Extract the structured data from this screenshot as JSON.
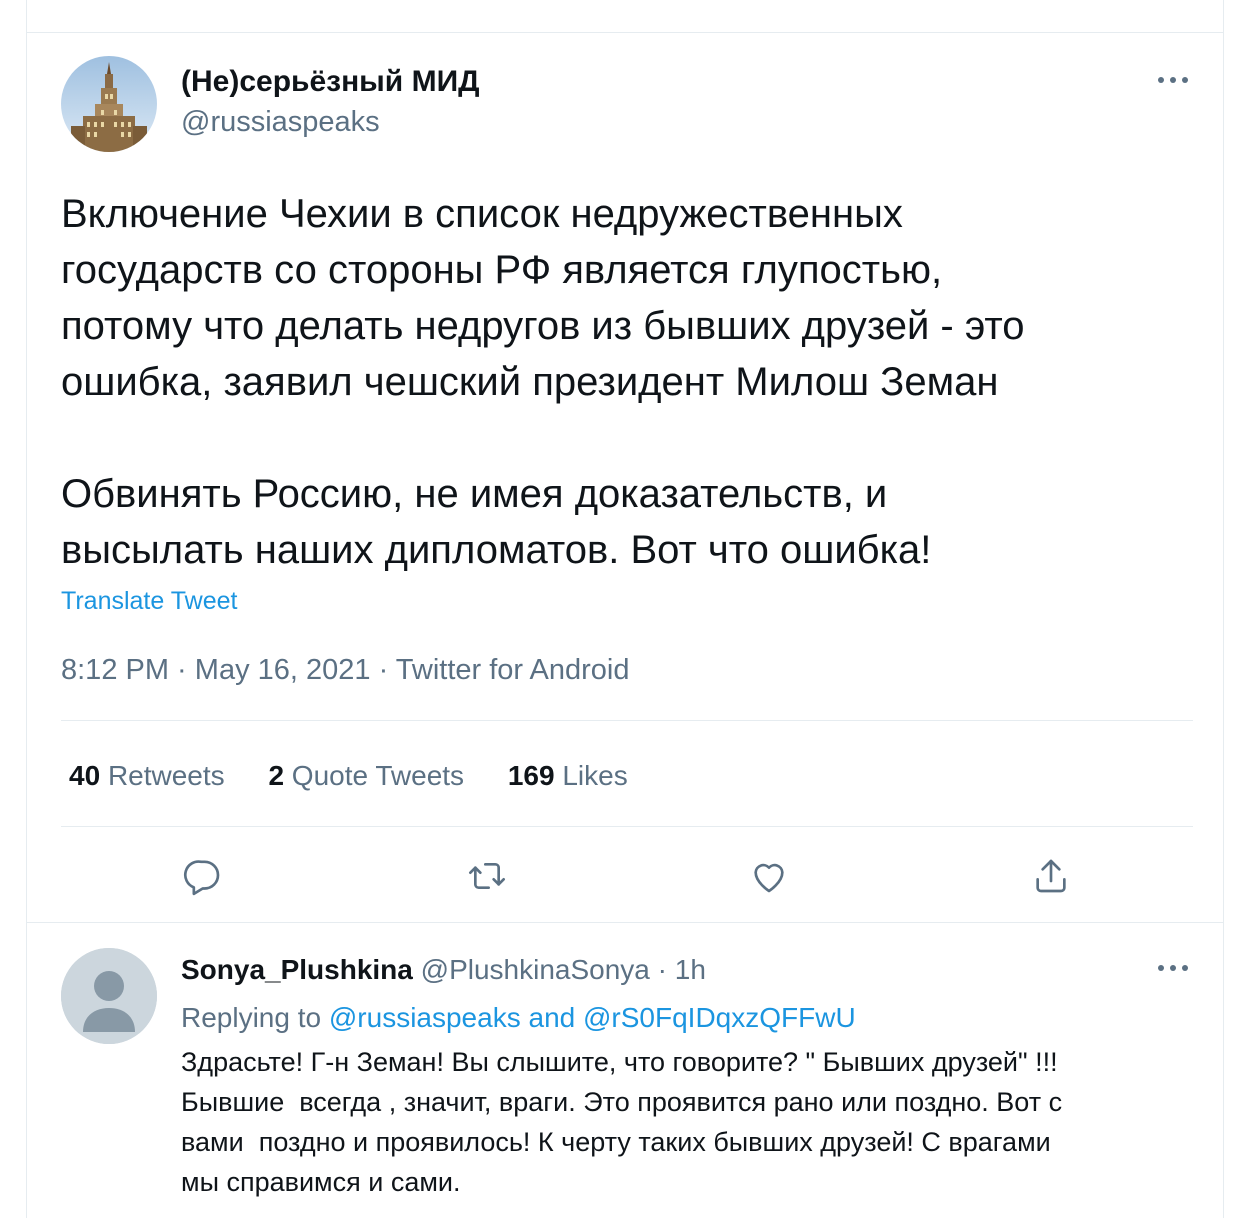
{
  "tweet": {
    "author_name": "(Не)серьёзный МИД",
    "author_handle": "@russiaspeaks",
    "paragraph_1": "Включение Чехии в список недружественных\nгосударств со стороны РФ является глупостью,\nпотому что делать недругов из бывших друзей - это\nошибка, заявил чешский президент Милош Земан",
    "paragraph_2": "Обвинять Россию, не имея доказательств, и\nвысылать наших дипломатов. Вот что ошибка!",
    "translate_label": "Translate Tweet",
    "time": "8:12 PM",
    "date": "May 16, 2021",
    "source": "Twitter for Android",
    "separator": " · "
  },
  "stats": {
    "retweets_count": "40",
    "retweets_label": "Retweets",
    "quotes_count": "2",
    "quotes_label": "Quote Tweets",
    "likes_count": "169",
    "likes_label": "Likes"
  },
  "actions": {
    "icons": [
      "reply-icon",
      "retweet-icon",
      "like-icon",
      "share-icon"
    ]
  },
  "reply": {
    "author_name": "Sonya_Plushkina",
    "author_handle": "@PlushkinaSonya",
    "age": "1h",
    "separator": " · ",
    "replying_prefix": "Replying to ",
    "replying_user_1": "@russiaspeaks",
    "replying_and": " and ",
    "replying_user_2": "@rS0FqIDqxzQFFwU",
    "lines": [
      "Здрасьте! Г-н Земан! Вы слышите, что говорите? \" Бывших друзей\" !!!",
      "Бывшие  всегда , значит, враги. Это проявится рано или поздно. Вот с",
      "вами  поздно и проявилось! К черту таких бывших друзей! С врагами",
      "мы справимся и сами."
    ]
  },
  "colors": {
    "text": "#0f1419",
    "secondary": "#5b7083",
    "link": "#1b95e0",
    "divider": "#e6ecf0"
  }
}
